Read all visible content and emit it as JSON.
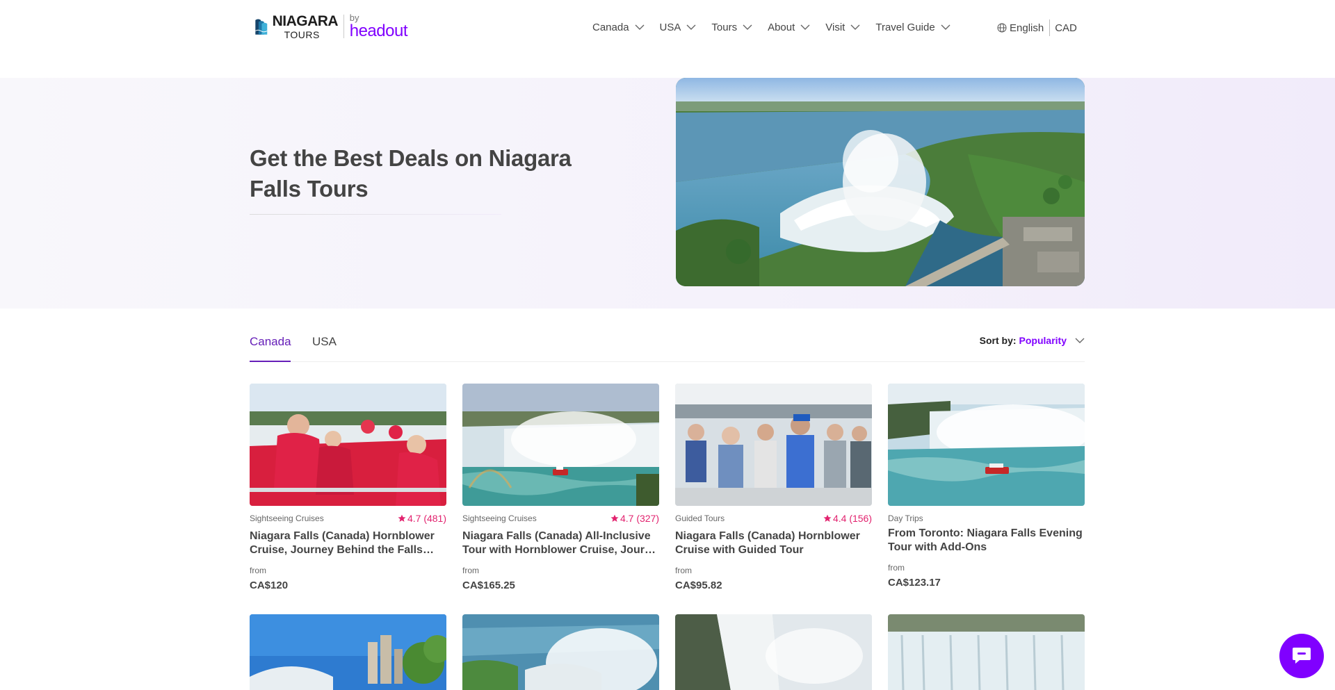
{
  "brand": {
    "name_line1": "NIAGARA",
    "name_line2": "TOURS",
    "by": "by",
    "partner": "headout"
  },
  "nav": {
    "items": [
      {
        "label": "Canada"
      },
      {
        "label": "USA"
      },
      {
        "label": "Tours"
      },
      {
        "label": "About"
      },
      {
        "label": "Visit"
      },
      {
        "label": "Travel Guide"
      }
    ],
    "language": "English",
    "currency": "CAD"
  },
  "hero": {
    "title": "Get the Best Deals on Niagara Falls Tours",
    "image_icon": "niagara-falls-aerial-image"
  },
  "tabs": {
    "items": [
      "Canada",
      "USA"
    ],
    "active": "Canada"
  },
  "sort": {
    "label": "Sort by:",
    "value": "Popularity"
  },
  "colors": {
    "accent": "#8000ff",
    "tab_active": "#661fb8",
    "rating": "#e2226e"
  },
  "cards": [
    {
      "category": "Sightseeing Cruises",
      "rating": "4.7",
      "reviews": "(481)",
      "title": "Niagara Falls (Canada) Hornblower Cruise, Journey Behind the Falls with…",
      "from": "from",
      "price": "CA$120"
    },
    {
      "category": "Sightseeing Cruises",
      "rating": "4.7",
      "reviews": "(327)",
      "title": "Niagara Falls (Canada) All-Inclusive Tour with Hornblower Cruise, Jour…",
      "from": "from",
      "price": "CA$165.25"
    },
    {
      "category": "Guided Tours",
      "rating": "4.4",
      "reviews": "(156)",
      "title": "Niagara Falls (Canada) Hornblower Cruise with Guided Tour",
      "from": "from",
      "price": "CA$95.82"
    },
    {
      "category": "Day Trips",
      "rating": "",
      "reviews": "",
      "title": "From Toronto: Niagara Falls Evening Tour with Add-Ons",
      "from": "from",
      "price": "CA$123.17"
    }
  ]
}
